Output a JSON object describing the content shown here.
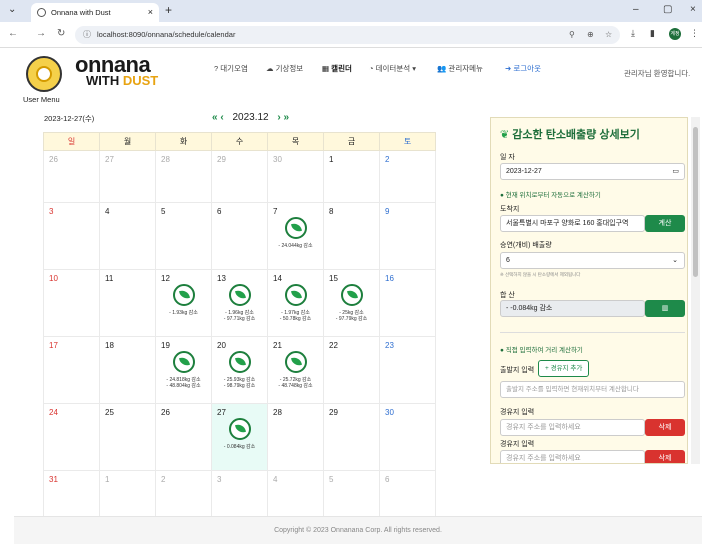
{
  "browser": {
    "tab_title": "Onnana with Dust",
    "url": "localhost:8090/onnana/schedule/calendar",
    "profile": "계정"
  },
  "brand": {
    "line1": "onnana",
    "line2a": "WITH ",
    "line2b": "DUST",
    "user_menu": "User Menu"
  },
  "menu": {
    "items": [
      {
        "label": "? 대기오염"
      },
      {
        "label": "☁ 기상정보"
      },
      {
        "label": "▦ 캘린더"
      },
      {
        "label": "◔ 데이터분석 ▾"
      },
      {
        "label": "👥 관리자메뉴"
      },
      {
        "label": "➜ 로그아웃"
      }
    ],
    "greeting": "관리자님 환영합니다."
  },
  "calendar": {
    "current_date": "2023-12-27(수)",
    "month_label": "2023.12",
    "nav": {
      "prev_year": "«",
      "prev": "‹",
      "next": "›",
      "next_year": "»"
    },
    "weekdays": [
      "일",
      "월",
      "화",
      "수",
      "목",
      "금",
      "토"
    ],
    "weeks": [
      [
        {
          "d": "26",
          "g": true
        },
        {
          "d": "27",
          "g": true
        },
        {
          "d": "28",
          "g": true
        },
        {
          "d": "29",
          "g": true
        },
        {
          "d": "30",
          "g": true
        },
        {
          "d": "1"
        },
        {
          "d": "2"
        }
      ],
      [
        {
          "d": "3"
        },
        {
          "d": "4"
        },
        {
          "d": "5"
        },
        {
          "d": "6"
        },
        {
          "d": "7",
          "leaf": true,
          "a": [
            "- 24.044kg 감소"
          ]
        },
        {
          "d": "8"
        },
        {
          "d": "9"
        }
      ],
      [
        {
          "d": "10"
        },
        {
          "d": "11"
        },
        {
          "d": "12",
          "leaf": true,
          "a": [
            "- 1.93kg 감소"
          ]
        },
        {
          "d": "13",
          "leaf": true,
          "a": [
            "- 1.96kg 감소",
            "- 97.71kg 감소"
          ]
        },
        {
          "d": "14",
          "leaf": true,
          "a": [
            "- 1.97kg 감소",
            "- 50.78kg 감소"
          ]
        },
        {
          "d": "15",
          "leaf": true,
          "a": [
            "- 25kg 감소",
            "- 97.79kg 감소"
          ]
        },
        {
          "d": "16"
        }
      ],
      [
        {
          "d": "17"
        },
        {
          "d": "18"
        },
        {
          "d": "19",
          "leaf": true,
          "a": [
            "- 24.818kg 감소",
            "- 48.804kg 감소"
          ]
        },
        {
          "d": "20",
          "leaf": true,
          "a": [
            "- 25.93kg 감소",
            "- 98.79kg 감소"
          ]
        },
        {
          "d": "21",
          "leaf": true,
          "a": [
            "- 25.72kg 감소",
            "- 48.748kg 감소"
          ]
        },
        {
          "d": "22"
        },
        {
          "d": "23"
        }
      ],
      [
        {
          "d": "24"
        },
        {
          "d": "25"
        },
        {
          "d": "26"
        },
        {
          "d": "27",
          "leaf": true,
          "today": true,
          "a": [
            "- 0.084kg 감소"
          ]
        },
        {
          "d": "28"
        },
        {
          "d": "29"
        },
        {
          "d": "30"
        }
      ],
      [
        {
          "d": "31"
        },
        {
          "d": "1",
          "g": true
        },
        {
          "d": "2",
          "g": true
        },
        {
          "d": "3",
          "g": true
        },
        {
          "d": "4",
          "g": true
        },
        {
          "d": "5",
          "g": true
        },
        {
          "d": "6",
          "g": true
        }
      ]
    ]
  },
  "panel": {
    "title": "감소한 탄소배출량 상세보기",
    "date_label": "일 자",
    "date_value": "2023-12-27",
    "auto_calc": "현재 위치로부터 자동으로 계산하기",
    "dest_label": "도착지",
    "dest_value": "서울특별시 마포구 양화로 160 홍대입구역",
    "calc_btn": "계산",
    "emission_label": "승연(개비) 배출량",
    "emission_value": "6",
    "emission_note": "※ 선택하지 않을 시 탄소량에서 제외됩니다",
    "total_label": "합 산",
    "total_value": "- -0.084kg 감소",
    "manual_calc": "직접 입력하여 거리 계산하기",
    "start_label": "출발지 입력",
    "add_waypoint": "+ 경유지 추가",
    "start_placeholder": "출발지 주소를 입력하면 현재위치부터 계산합니다",
    "way1_label": "경유지 입력",
    "way1_placeholder": "경유지 주소를 입력하세요",
    "way2_label": "경유지 입력",
    "way2_placeholder": "경유지 주소를 입력하세요",
    "delete_btn": "삭제"
  },
  "footer": {
    "text": "Copyright © 2023 Onnanana Corp. All rights reserved."
  },
  "colors": {
    "accent": "#1e8a4a",
    "sunday": "#d9332f",
    "saturday": "#2f6fd0",
    "panel_bg": "#fffbe8"
  }
}
